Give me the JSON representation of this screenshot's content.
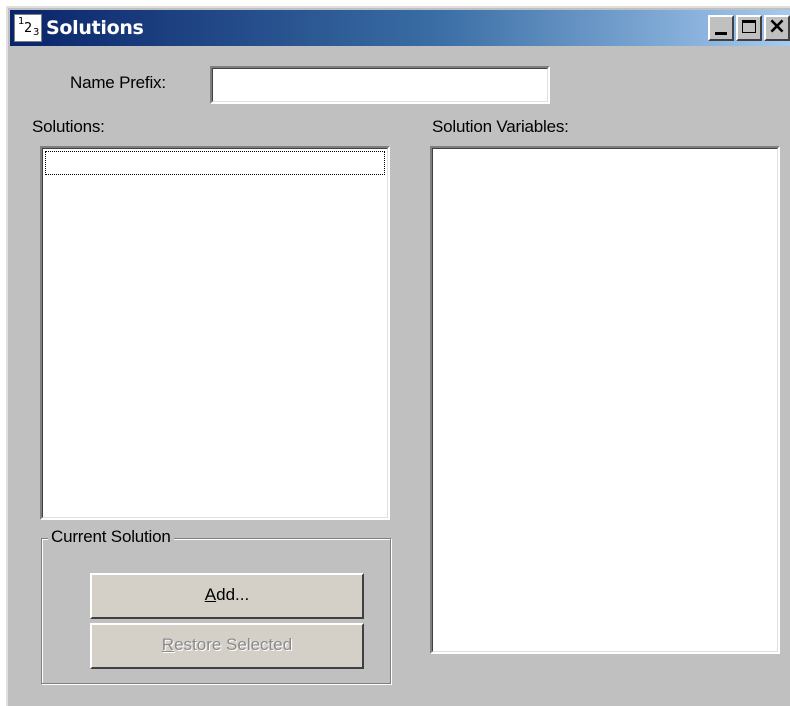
{
  "window": {
    "title": "Solutions",
    "icon_name": "variables-123-icon"
  },
  "caption_buttons": {
    "minimize": "minimize",
    "maximize": "maximize",
    "close": "close"
  },
  "name_prefix": {
    "label": "Name Prefix:",
    "value": ""
  },
  "solutions": {
    "label": "Solutions:",
    "items": []
  },
  "solution_variables": {
    "label": "Solution Variables:",
    "items": []
  },
  "current_solution": {
    "legend": "Current Solution",
    "add_button": {
      "access_key": "A",
      "rest": "dd...",
      "enabled": true
    },
    "restore_button": {
      "access_key": "R",
      "rest": "estore Selected",
      "enabled": false
    }
  },
  "colors": {
    "face": "#c0c0c0",
    "title_start": "#0a246a",
    "title_end": "#a6caf0",
    "field": "#ffffff",
    "disabled_text": "#8a8a8a"
  }
}
